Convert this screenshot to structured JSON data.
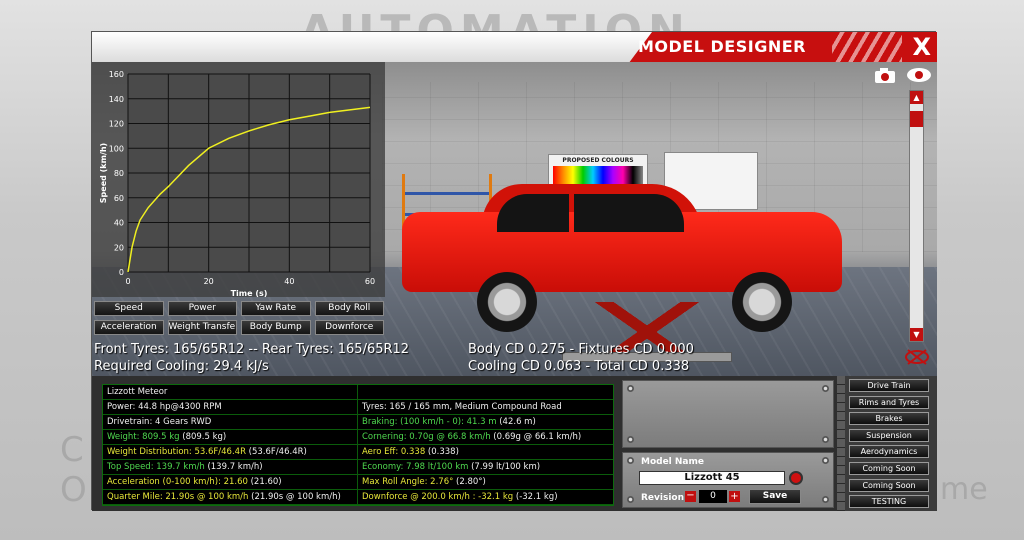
{
  "window": {
    "title": "MODEL DESIGNER",
    "close_label": "X"
  },
  "background": {
    "logo_text": "AUTOMATION",
    "side_left_1": "C",
    "side_left_2": "O",
    "side_right": "me"
  },
  "chart_data": {
    "type": "line",
    "title": "",
    "xlabel": "Time (s)",
    "ylabel": "Speed (km/h)",
    "xlim": [
      0,
      60
    ],
    "ylim": [
      0,
      160
    ],
    "x_ticks": [
      0,
      20,
      40,
      60
    ],
    "y_ticks": [
      0,
      20,
      40,
      60,
      80,
      100,
      120,
      140,
      160
    ],
    "grid": true,
    "line_color": "#f0f020",
    "series": [
      {
        "x": [
          0,
          1,
          2,
          3,
          5,
          8,
          10,
          15,
          20,
          25,
          30,
          35,
          40,
          45,
          50,
          55,
          60
        ],
        "values": [
          0,
          20,
          33,
          42,
          52,
          63,
          69,
          86,
          100,
          108,
          114,
          119,
          123,
          126,
          129,
          131,
          133
        ]
      }
    ]
  },
  "graph_buttons": [
    "Speed",
    "Power",
    "Yaw Rate",
    "Body Roll",
    "Acceleration",
    "Weight Transfer",
    "Body Bump",
    "Downforce"
  ],
  "scene": {
    "poster_title": "PROPOSED COLOURS",
    "icons": {
      "camera": "camera-icon",
      "eye": "eye-icon",
      "reset": "reset-view-icon"
    }
  },
  "info_lines": {
    "tyres": "Front Tyres: 165/65R12 -- Rear Tyres: 165/65R12",
    "cooling_required": "Required Cooling: 29.4 kJ/s",
    "body_cd": "Body CD 0.275 - Fixtures CD 0.000",
    "total_cd": "Cooling CD 0.063 - Total CD 0.338"
  },
  "stats": {
    "rows": [
      {
        "left": {
          "text": "Lizzott Meteor",
          "color": "w"
        },
        "right": {
          "text": "",
          "color": "w"
        }
      },
      {
        "left": {
          "text": "Power: 44.8 hp@4300 RPM",
          "color": "w"
        },
        "right": {
          "text": "Tyres: 165 / 165 mm, Medium Compound Road",
          "color": "w"
        }
      },
      {
        "left": {
          "text": "Drivetrain: 4 Gears RWD",
          "color": "w"
        },
        "right": {
          "text": "Braking: (100 km/h - 0): 41.3 m",
          "extra": " (42.6 m)",
          "color": "g"
        }
      },
      {
        "left": {
          "text": "Weight: 809.5 kg",
          "extra": " (809.5 kg)",
          "color": "g"
        },
        "right": {
          "text": "Cornering: 0.70g @ 66.8 km/h",
          "extra": " (0.69g @ 66.1 km/h)",
          "color": "g"
        }
      },
      {
        "left": {
          "text": "Weight Distribution: 53.6F/46.4R",
          "extra": " (53.6F/46.4R)",
          "color": "y"
        },
        "right": {
          "text": "Aero Eff: 0.338",
          "extra": " (0.338)",
          "color": "y"
        }
      },
      {
        "left": {
          "text": "Top Speed: 139.7 km/h",
          "extra": " (139.7 km/h)",
          "color": "g"
        },
        "right": {
          "text": "Economy: 7.98 lt/100 km",
          "extra": " (7.99 lt/100 km)",
          "color": "g"
        }
      },
      {
        "left": {
          "text": "Acceleration (0-100 km/h): 21.60",
          "extra": " (21.60)",
          "color": "y"
        },
        "right": {
          "text": "Max Roll Angle: 2.76°",
          "extra": " (2.80°)",
          "color": "y"
        }
      },
      {
        "left": {
          "text": "Quarter Mile: 21.90s @ 100 km/h",
          "extra": " (21.90s @ 100 km/h)",
          "color": "y"
        },
        "right": {
          "text": "Downforce @ 200.0 km/h : -32.1 kg",
          "extra": " (-32.1 kg)",
          "color": "y"
        }
      }
    ]
  },
  "model": {
    "name_label": "Model Name",
    "name_value": "Lizzott 45",
    "revision_label": "Revision",
    "revision_value": "0",
    "minus": "−",
    "plus": "+",
    "save_label": "Save"
  },
  "side_menu": [
    "Drive Train",
    "Rims and Tyres",
    "Brakes",
    "Suspension",
    "Aerodynamics",
    "Coming Soon",
    "Coming Soon",
    "TESTING"
  ],
  "colors": {
    "accent": "#c70f0f",
    "green_text": "#4fd84f",
    "yellow_text": "#e6e63a",
    "car": "#e01010"
  }
}
